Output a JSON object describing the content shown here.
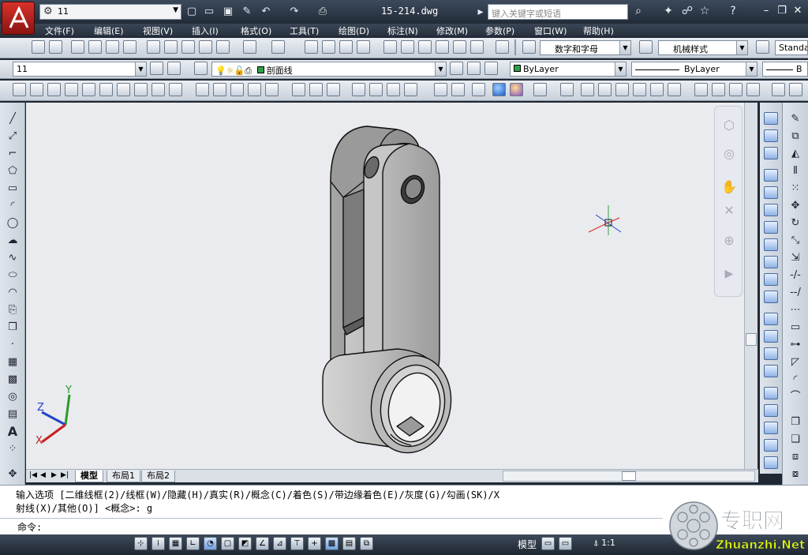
{
  "app": {
    "logo": "autocad-a-logo",
    "workspace": "11",
    "doc_title": "15-214.dwg",
    "search_placeholder": "键入关键字或短语"
  },
  "menu": [
    "文件(F)",
    "编辑(E)",
    "视图(V)",
    "插入(I)",
    "格式(O)",
    "工具(T)",
    "绘图(D)",
    "标注(N)",
    "修改(M)",
    "参数(P)",
    "窗口(W)",
    "帮助(H)"
  ],
  "toolbar1": {
    "text_style": "数字和字母",
    "dim_style": "机械样式",
    "table_style": "Standa"
  },
  "toolbar2": {
    "workspace_combo": "11",
    "layer": "剖面线",
    "color": "ByLayer",
    "linetype": "ByLayer",
    "lineweight": "B"
  },
  "tabs": [
    "模型",
    "布局1",
    "布局2"
  ],
  "command": {
    "history_line1": "输入选项 [二维线框(2)/线框(W)/隐藏(H)/真实(R)/概念(C)/着色(S)/带边缘着色(E)/灰度(G)/勾画(SK)/X",
    "history_line2": "射线(X)/其他(O)] <概念>: g",
    "prompt": "命令:"
  },
  "status": {
    "model": "模型",
    "scale": "1:1",
    "watermark_main": "专职网",
    "watermark_url": "Zhuanzhi.Net"
  },
  "ucs": {
    "x": "X",
    "y": "Y",
    "z": "Z"
  },
  "colors": {
    "title_bg": "#2b3542",
    "toolbar_bg": "#dde3ea",
    "viewport_bg": "#e9ebee",
    "layer_color": "#2ea044"
  }
}
